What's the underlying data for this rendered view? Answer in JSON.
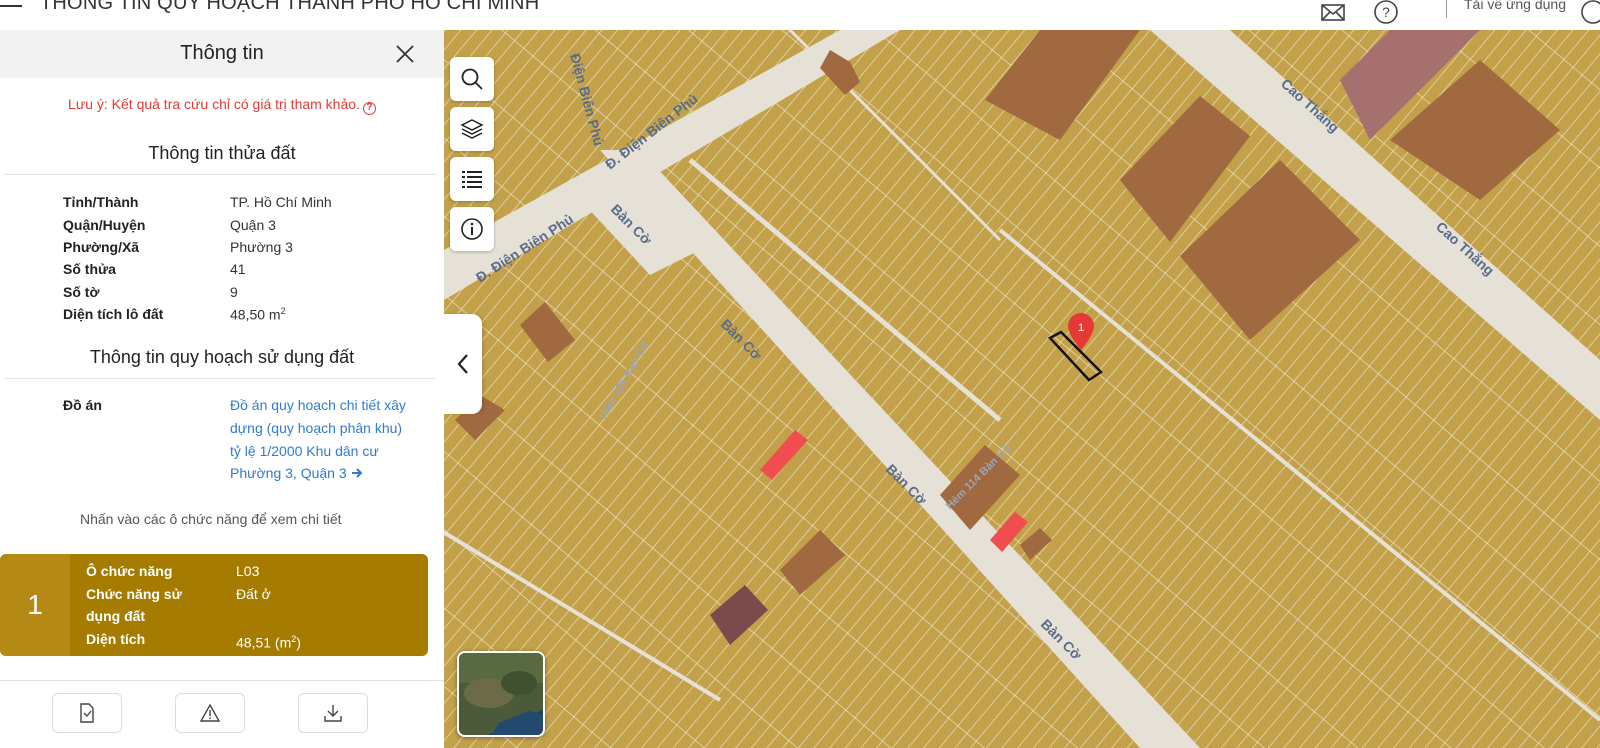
{
  "app": {
    "title": "THÔNG TIN QUY HOẠCH THÀNH PHỐ HỒ CHÍ MINH",
    "download_label": "Tải về ứng dụng"
  },
  "panel": {
    "title": "Thông tin",
    "note": "Lưu ý: Kết quả tra cứu chỉ có giá trị tham khảo.",
    "land_section_title": "Thông tin thửa đất",
    "land_info": [
      {
        "label": "Tỉnh/Thành",
        "value": "TP. Hồ Chí Minh"
      },
      {
        "label": "Quận/Huyện",
        "value": "Quận 3"
      },
      {
        "label": "Phường/Xã",
        "value": "Phường 3"
      },
      {
        "label": "Số thửa",
        "value": "41"
      },
      {
        "label": "Số tờ",
        "value": "9"
      },
      {
        "label": "Diện tích lô đất",
        "value": "48,50 m",
        "sup": "2"
      }
    ],
    "planning_section_title": "Thông tin quy hoạch sử dụng đất",
    "project_label": "Đồ án",
    "project_link": "Đồ án quy hoạch chi tiết xây dựng (quy hoạch phân khu) tỷ lệ 1/2000 Khu dân cư Phường 3, Quận 3",
    "hint": "Nhấn vào các ô chức năng để xem chi tiết",
    "function_card": {
      "index": "1",
      "color": "#a57b00",
      "rows": [
        {
          "label": "Ô chức năng",
          "value": "L03"
        },
        {
          "label": "Chức năng sử dụng đất",
          "value": "Đất ở"
        },
        {
          "label": "Diện tích",
          "value": "48,51 (m",
          "sup": "2",
          "tail": ")"
        }
      ]
    }
  },
  "map": {
    "streets": [
      "Đ. Điện Biên Phủ",
      "Đ. Điện Biên Phủ",
      "Điện Biên Phủ",
      "Bàn Cờ",
      "Bàn Cờ",
      "Bàn Cờ",
      "Bàn Cờ",
      "Cao Thắng",
      "Cao Thắng",
      "Hẻm 114 Bàn Cờ",
      "Hẻm 126 Bàn Cờ"
    ],
    "marker_label": "1",
    "colors": {
      "residential": "#c3a14a",
      "road": "#e6e1d6",
      "public": "#a0693f",
      "commercial": "#a6706e",
      "red": "#f04e4e",
      "marker": "#e53935"
    }
  },
  "icons": {
    "top": [
      "mail-icon",
      "help-icon",
      "user-icon"
    ],
    "map_tools": [
      "search-icon",
      "layers-icon",
      "list-icon",
      "info-icon"
    ],
    "footer": [
      "document-icon",
      "warning-icon",
      "download-icon"
    ]
  }
}
